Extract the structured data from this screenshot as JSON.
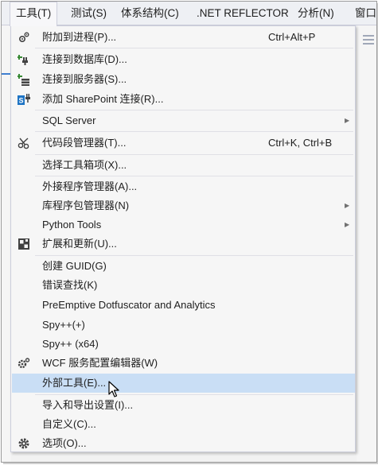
{
  "menubar": {
    "items": [
      {
        "label": "工具(T)",
        "active": true
      },
      {
        "label": "测试(S)"
      },
      {
        "label": "体系结构(C)"
      },
      {
        "label": ".NET REFLECTOR"
      },
      {
        "label": "分析(N)"
      },
      {
        "label": "窗口"
      }
    ]
  },
  "menu": {
    "items": [
      {
        "label": "附加到进程(P)...",
        "shortcut": "Ctrl+Alt+P",
        "icon": "attach-process-icon"
      },
      {
        "label": "连接到数据库(D)...",
        "icon": "connect-database-icon"
      },
      {
        "label": "连接到服务器(S)...",
        "icon": "connect-server-icon"
      },
      {
        "label": "添加 SharePoint 连接(R)...",
        "icon": "sharepoint-icon"
      },
      {
        "label": "SQL Server",
        "submenu": true
      },
      {
        "label": "代码段管理器(T)...",
        "shortcut": "Ctrl+K, Ctrl+B",
        "icon": "code-snippet-icon"
      },
      {
        "label": "选择工具箱项(X)..."
      },
      {
        "label": "外接程序管理器(A)..."
      },
      {
        "label": "库程序包管理器(N)",
        "submenu": true
      },
      {
        "label": "Python Tools",
        "submenu": true
      },
      {
        "label": "扩展和更新(U)...",
        "icon": "extensions-icon"
      },
      {
        "label": "创建 GUID(G)"
      },
      {
        "label": "错误查找(K)"
      },
      {
        "label": "PreEmptive Dotfuscator and Analytics"
      },
      {
        "label": "Spy++(+)"
      },
      {
        "label": "Spy++ (x64)"
      },
      {
        "label": "WCF 服务配置编辑器(W)",
        "icon": "wcf-config-icon"
      },
      {
        "label": "外部工具(E)...",
        "highlighted": true
      },
      {
        "label": "导入和导出设置(I)..."
      },
      {
        "label": "自定义(C)..."
      },
      {
        "label": "选项(O)...",
        "icon": "gear-icon"
      }
    ]
  },
  "colors": {
    "highlight": "#c9def5",
    "menu_background": "#f6f6f6",
    "menubar_background": "#eef0f4",
    "accent_blue": "#3f7fd0"
  }
}
